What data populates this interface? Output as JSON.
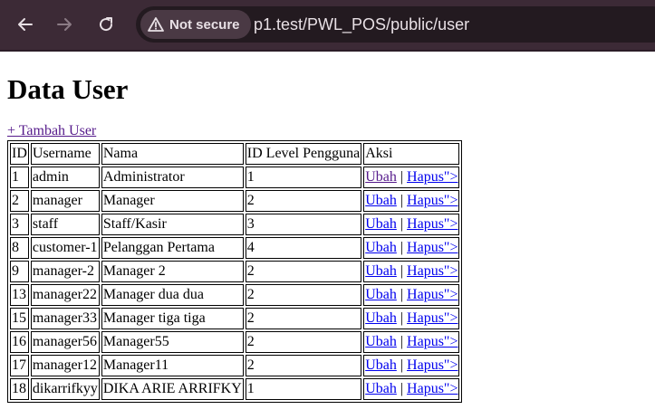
{
  "browser": {
    "security_label": "Not secure",
    "url": "p1.test/PWL_POS/public/user"
  },
  "page": {
    "title": "Data User",
    "add_link": "+ Tambah User"
  },
  "table": {
    "headers": [
      "ID",
      "Username",
      "Nama",
      "ID Level Pengguna",
      "Aksi"
    ],
    "action_edit": "Ubah",
    "action_sep": "|",
    "action_delete": "Hapus\">",
    "rows": [
      {
        "id": "1",
        "username": "admin",
        "nama": "Administrator",
        "level": "1"
      },
      {
        "id": "2",
        "username": "manager",
        "nama": "Manager",
        "level": "2"
      },
      {
        "id": "3",
        "username": "staff",
        "nama": "Staff/Kasir",
        "level": "3"
      },
      {
        "id": "8",
        "username": "customer-1",
        "nama": "Pelanggan Pertama",
        "level": "4"
      },
      {
        "id": "9",
        "username": "manager-2",
        "nama": "Manager 2",
        "level": "2"
      },
      {
        "id": "13",
        "username": "manager22",
        "nama": "Manager dua dua",
        "level": "2"
      },
      {
        "id": "15",
        "username": "manager33",
        "nama": "Manager tiga tiga",
        "level": "2"
      },
      {
        "id": "16",
        "username": "manager56",
        "nama": "Manager55",
        "level": "2"
      },
      {
        "id": "17",
        "username": "manager12",
        "nama": "Manager11",
        "level": "2"
      },
      {
        "id": "18",
        "username": "dikarrifkyy",
        "nama": "DIKA ARIE ARRIFKY",
        "level": "1"
      }
    ]
  },
  "colors": {
    "chrome_bg": "#3c2a36",
    "visited_link": "#551a8b",
    "link": "#0000ee"
  }
}
